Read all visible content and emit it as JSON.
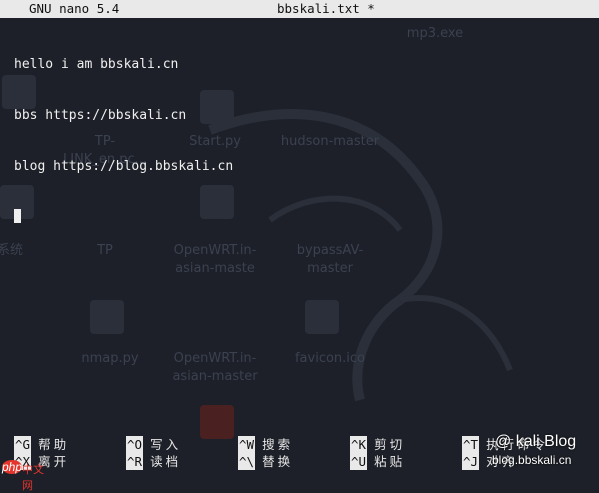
{
  "titlebar": {
    "version": "GNU nano 5.4",
    "filename": "bbskali.txt *"
  },
  "editor": {
    "lines": [
      "hello i am bbskali.cn",
      "bbs https://bbskali.cn",
      "blog https://blog.bbskali.cn"
    ]
  },
  "shortcuts": {
    "row1": [
      {
        "key": "^G",
        "label": "帮助"
      },
      {
        "key": "^O",
        "label": "写入"
      },
      {
        "key": "^W",
        "label": "搜索"
      },
      {
        "key": "^K",
        "label": "剪切"
      },
      {
        "key": "^T",
        "label": "执行命令"
      }
    ],
    "row2": [
      {
        "key": "^X",
        "label": "离开"
      },
      {
        "key": "^R",
        "label": "读档"
      },
      {
        "key": "^\\",
        "label": "替换"
      },
      {
        "key": "^U",
        "label": "粘贴"
      },
      {
        "key": "^J",
        "label": "对齐"
      }
    ]
  },
  "watermark": {
    "blog": "@ kali Blog",
    "url": "blog.bbskali.cn",
    "logo": "php",
    "logo_text": "中文网"
  },
  "desktop_ghosts": [
    "TP-LINK_en.pc...",
    "Start.py",
    "hudson-master",
    "系统",
    "TP",
    "OpenWRT.in-asian-maste",
    "bypassAV-master",
    "nmap.py",
    "OpenWRT.in-asian-master",
    "favicon.ico",
    "mp3.exe"
  ],
  "colors": {
    "titlebar_bg": "#e9e9e9",
    "terminal_bg": "#1d2028",
    "text": "#f0f0f0"
  }
}
